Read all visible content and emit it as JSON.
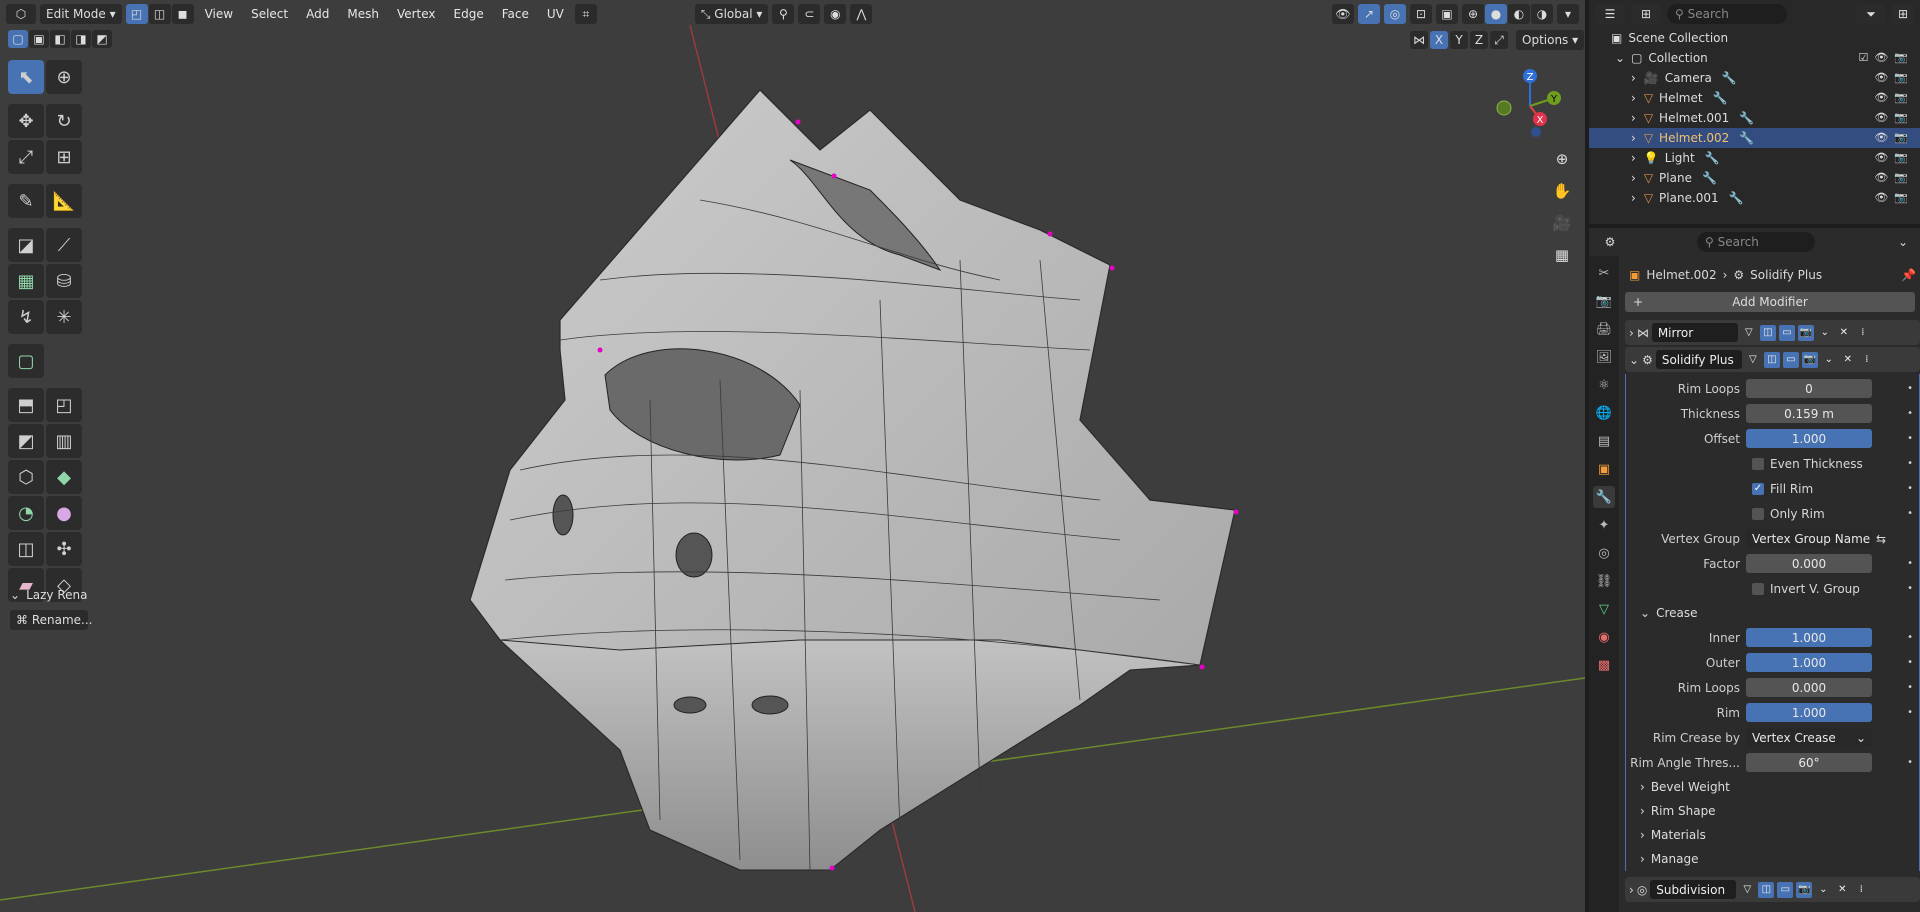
{
  "header": {
    "editor_icon": "cube-icon",
    "mode": "Edit Mode",
    "menus": [
      "View",
      "Select",
      "Add",
      "Mesh",
      "Vertex",
      "Edge",
      "Face",
      "UV"
    ],
    "orientation": "Global",
    "options": "Options",
    "axes": [
      "X",
      "Y",
      "Z"
    ]
  },
  "viewport": {
    "lazy_panel_label": "Lazy Rena",
    "rename_button": "Rename...",
    "gizmo_axes": {
      "z": "Z",
      "y": "Y",
      "x": "X"
    }
  },
  "outliner": {
    "search_placeholder": "Search",
    "scene_collection": "Scene Collection",
    "collection": "Collection",
    "items": [
      {
        "name": "Camera",
        "icon": "camera-icon"
      },
      {
        "name": "Helmet",
        "icon": "mesh-icon"
      },
      {
        "name": "Helmet.001",
        "icon": "mesh-icon"
      },
      {
        "name": "Helmet.002",
        "icon": "mesh-icon",
        "selected": true
      },
      {
        "name": "Light",
        "icon": "light-icon"
      },
      {
        "name": "Plane",
        "icon": "mesh-icon"
      },
      {
        "name": "Plane.001",
        "icon": "mesh-icon"
      }
    ]
  },
  "properties": {
    "search_placeholder": "Search",
    "breadcrumb_object": "Helmet.002",
    "breadcrumb_modifier": "Solidify Plus",
    "add_modifier": "Add Modifier",
    "modifiers": [
      "Mirror",
      "Solidify Plus",
      "Subdivision"
    ],
    "fields": {
      "rim_loops_label": "Rim Loops",
      "rim_loops": "0",
      "thickness_label": "Thickness",
      "thickness": "0.159 m",
      "offset_label": "Offset",
      "offset": "1.000",
      "even_thickness": "Even Thickness",
      "fill_rim": "Fill Rim",
      "only_rim": "Only Rim",
      "vertex_group_label": "Vertex Group",
      "vertex_group": "Vertex Group Name",
      "factor_label": "Factor",
      "factor": "0.000",
      "invert_v_group": "Invert V. Group"
    },
    "crease": {
      "title": "Crease",
      "inner_label": "Inner",
      "inner": "1.000",
      "outer_label": "Outer",
      "outer": "1.000",
      "rim_loops_label": "Rim Loops",
      "rim_loops": "0.000",
      "rim_label": "Rim",
      "rim": "1.000",
      "rim_crease_by_label": "Rim Crease by",
      "rim_crease_by": "Vertex Crease",
      "rim_angle_label": "Rim Angle Thres...",
      "rim_angle": "60°"
    },
    "subpanels": [
      "Bevel Weight",
      "Rim Shape",
      "Materials",
      "Manage"
    ]
  },
  "colors": {
    "accent": "#4772b3",
    "viewport": "#3d3d3d",
    "mesh": "#b8b8b8",
    "vertex_selected": "#e600c8"
  }
}
